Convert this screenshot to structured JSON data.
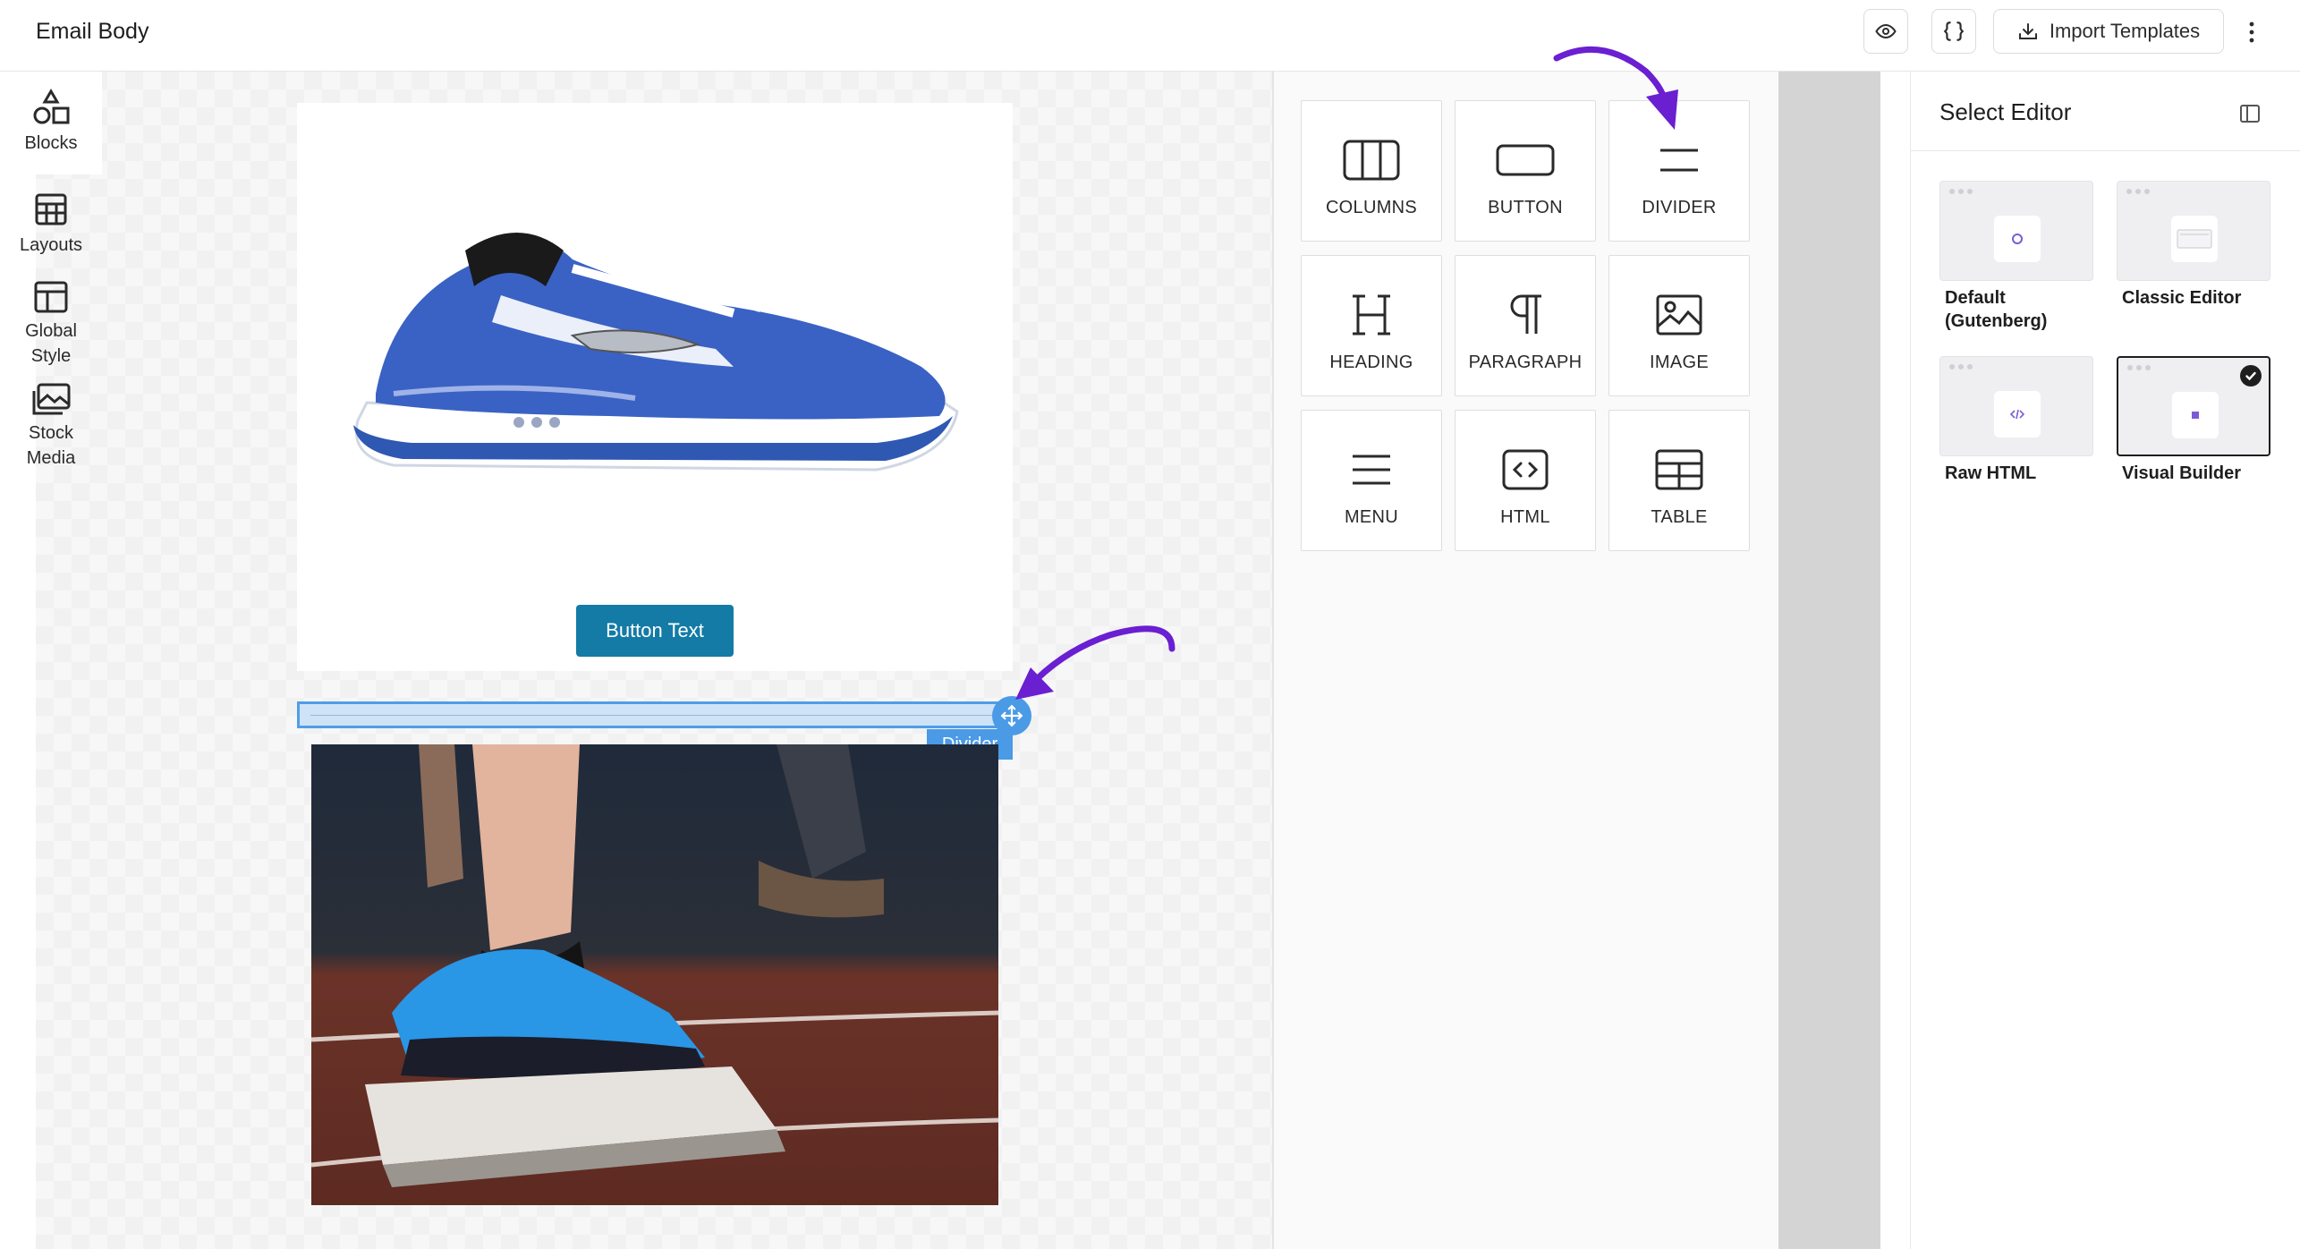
{
  "header": {
    "title": "Email Body",
    "preview_icon": "eye-icon",
    "code_icon": "braces-icon",
    "import_label": "Import Templates",
    "import_icon": "download-icon",
    "more_icon": "kebab-icon"
  },
  "canvas": {
    "button_label": "Button Text",
    "divider_tag": "Divider",
    "move_icon": "move-icon",
    "colors": {
      "button": "#137ba5",
      "selection": "#4a9ae6"
    }
  },
  "blocks": [
    {
      "label": "COLUMNS",
      "icon": "columns-icon"
    },
    {
      "label": "BUTTON",
      "icon": "button-icon"
    },
    {
      "label": "DIVIDER",
      "icon": "divider-icon"
    },
    {
      "label": "HEADING",
      "icon": "heading-icon"
    },
    {
      "label": "PARAGRAPH",
      "icon": "paragraph-icon"
    },
    {
      "label": "IMAGE",
      "icon": "image-icon"
    },
    {
      "label": "MENU",
      "icon": "menu-icon"
    },
    {
      "label": "HTML",
      "icon": "html-icon"
    },
    {
      "label": "TABLE",
      "icon": "table-icon"
    }
  ],
  "tabs": {
    "blocks": "Blocks",
    "layouts": "Layouts",
    "global_style_1": "Global",
    "global_style_2": "Style",
    "stock_media_1": "Stock",
    "stock_media_2": "Media"
  },
  "editor": {
    "title": "Select Editor",
    "options": [
      {
        "label_1": "Default",
        "label_2": "(Gutenberg)"
      },
      {
        "label_1": "Classic Editor",
        "label_2": ""
      },
      {
        "label_1": "Raw HTML",
        "label_2": ""
      },
      {
        "label_1": "Visual Builder",
        "label_2": "",
        "selected": true
      }
    ]
  },
  "annotation_color": "#6a1fd1"
}
